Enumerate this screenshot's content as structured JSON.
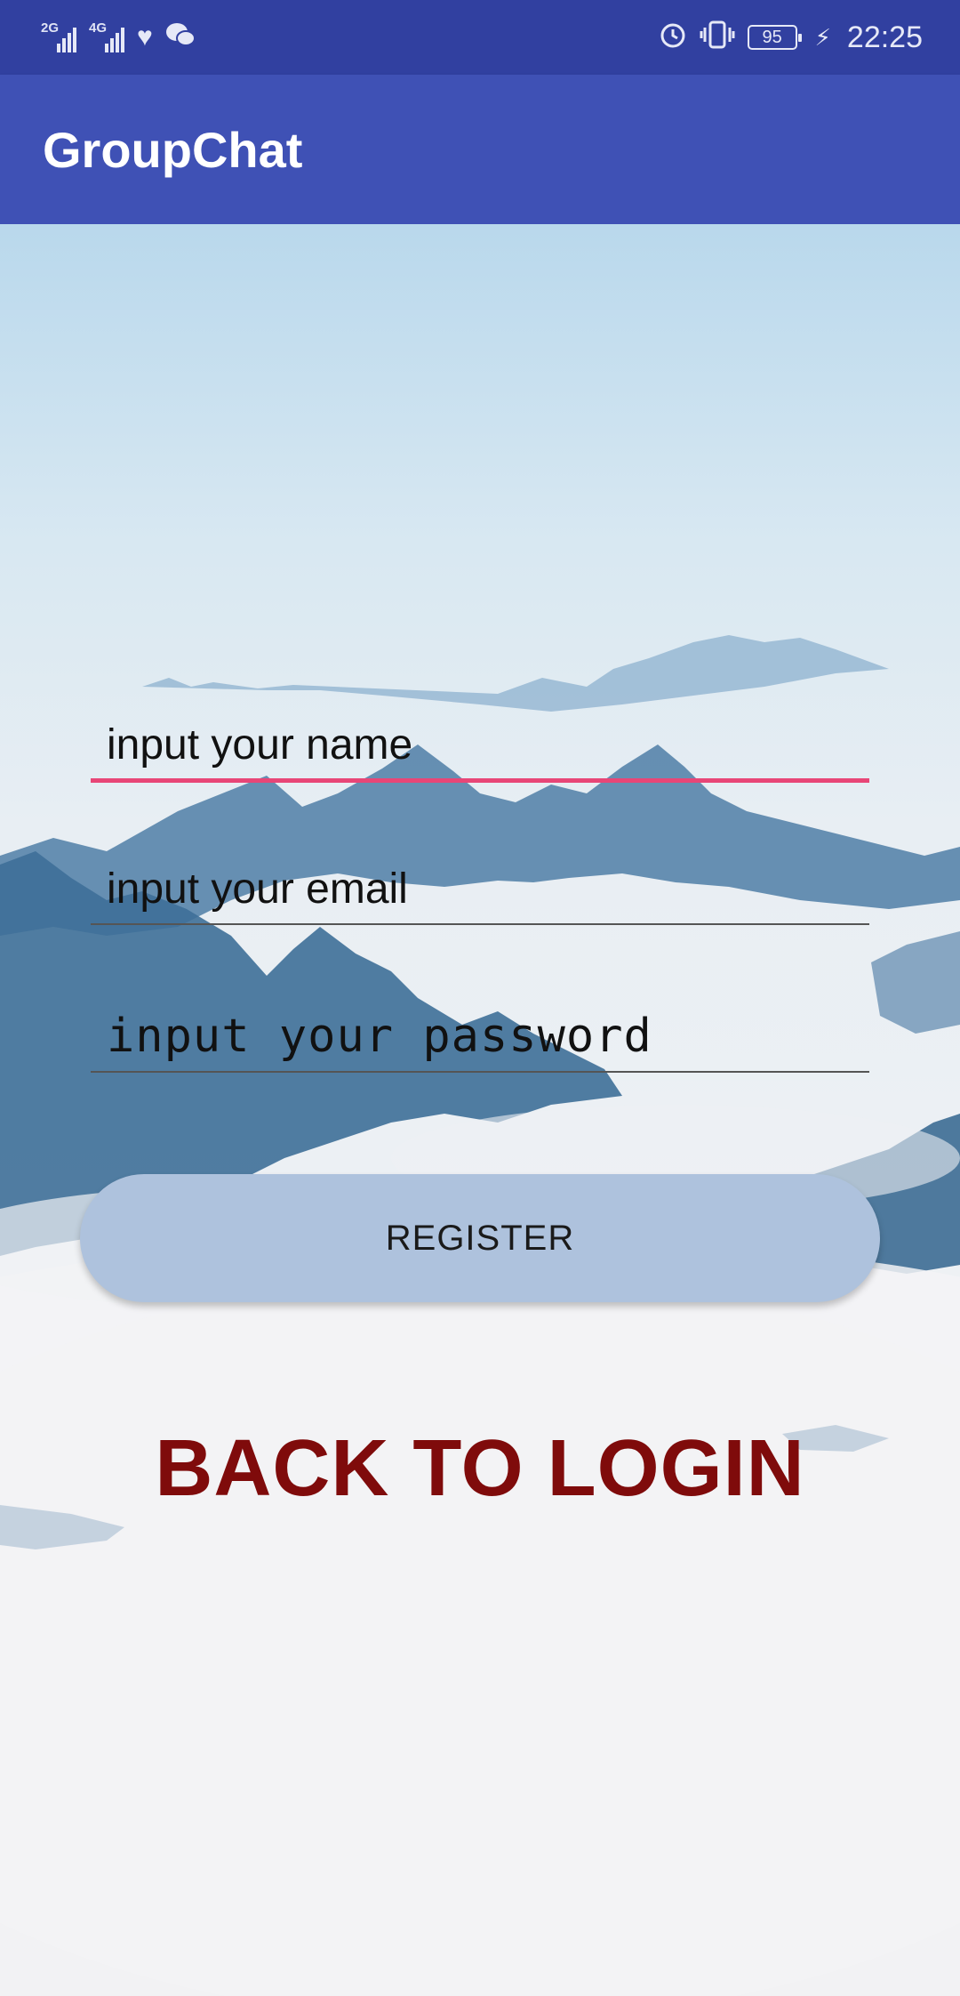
{
  "status_bar": {
    "network_1": "2G",
    "network_2": "4G",
    "battery": "95",
    "time": "22:25",
    "icons": [
      "signal-icon",
      "signal-icon",
      "health-icon",
      "wechat-icon",
      "alarm-icon",
      "vibrate-icon",
      "battery-icon",
      "charging-icon"
    ]
  },
  "app_bar": {
    "title": "GroupChat"
  },
  "form": {
    "name_placeholder": "input your name",
    "email_placeholder": "input your email",
    "password_placeholder": "input your password",
    "register_label": "REGISTER",
    "back_to_login_label": "BACK TO LOGIN"
  },
  "colors": {
    "status_bar": "#3140a0",
    "app_bar": "#3f51b5",
    "focused_underline": "#e84677",
    "register_button": "#aec2dd",
    "back_to_login": "#7f0b0b"
  }
}
